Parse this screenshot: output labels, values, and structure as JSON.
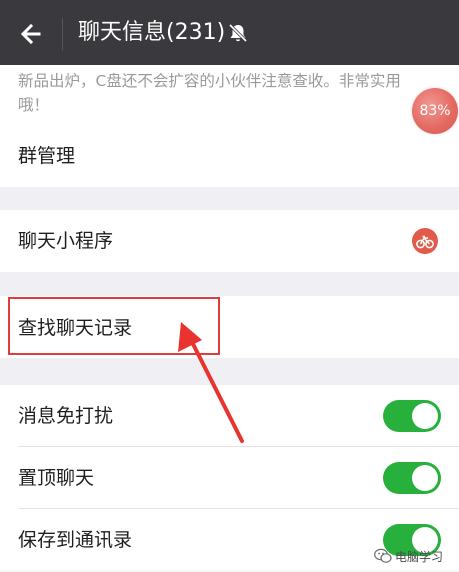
{
  "header": {
    "title": "聊天信息(231)",
    "back_icon": "arrow-left-icon",
    "mute_icon": "bell-off-icon"
  },
  "announcement": {
    "text": "新品出炉，C盘还不会扩容的小伙伴注意查收。非常实用哦！"
  },
  "progress_badge": {
    "label": "83%",
    "value": 83
  },
  "rows": {
    "group_manage": "群管理",
    "mini_program": "聊天小程序",
    "mini_program_icon": "mini-program-bike-icon",
    "search_history": "查找聊天记录",
    "do_not_disturb": "消息免打扰",
    "pin_chat": "置顶聊天",
    "save_contacts": "保存到通讯录"
  },
  "toggles": {
    "do_not_disturb": true,
    "pin_chat": true,
    "save_contacts": true
  },
  "watermark": {
    "text": "电脑学习",
    "icon": "wechat-icon"
  },
  "colors": {
    "header_bg": "#3a3a3e",
    "toggle_on": "#27b13c",
    "highlight": "#e23b3b",
    "page_bg": "#efeff4"
  }
}
